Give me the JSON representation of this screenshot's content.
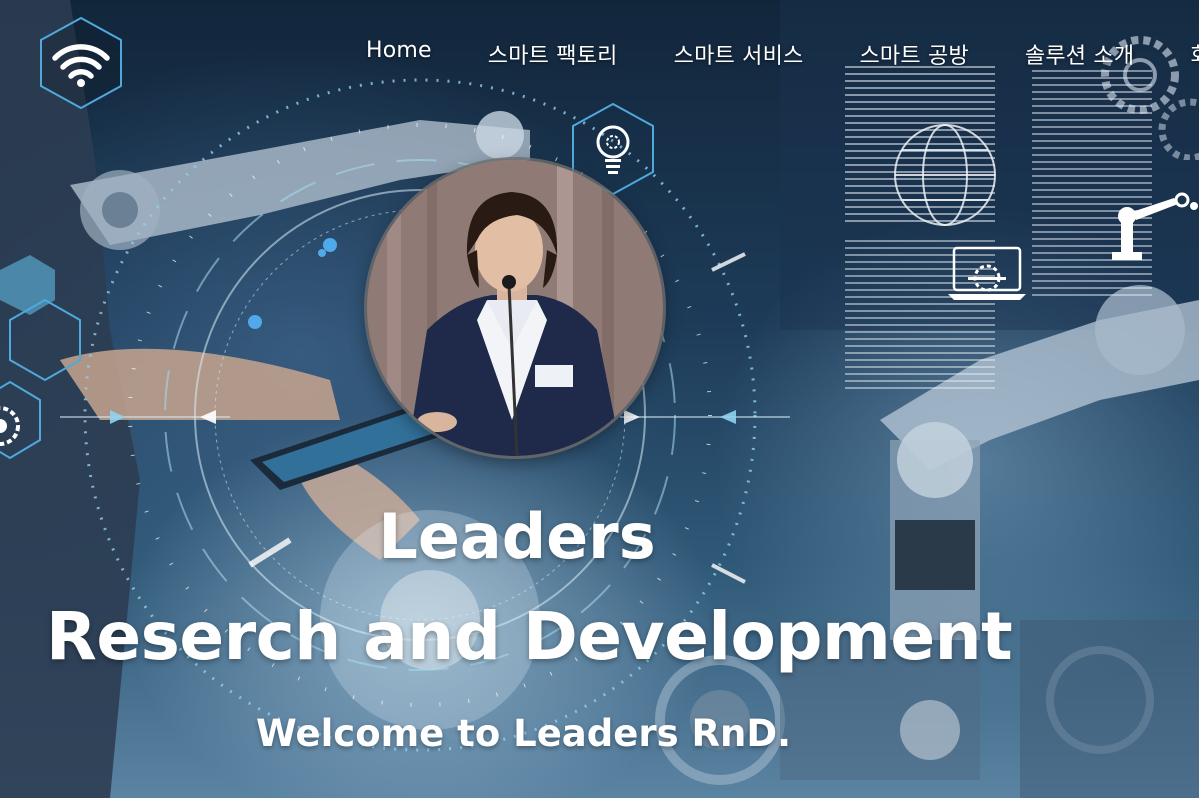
{
  "nav": {
    "items": [
      {
        "label": "Home"
      },
      {
        "label": "스마트 팩토리"
      },
      {
        "label": "스마트 서비스"
      },
      {
        "label": "스마트 공방"
      },
      {
        "label": "솔루션 소개"
      },
      {
        "label": "회"
      }
    ]
  },
  "hero": {
    "line1": "Leaders",
    "line2": "Reserch and Development",
    "subtitle": "Welcome to Leaders RnD."
  },
  "icons": {
    "logo": "wifi-icon",
    "idea": "lightbulb-gear-icon",
    "globe": "globe-icon",
    "laptop": "laptop-gear-icon",
    "robot": "robot-arm-icon",
    "portrait": "speaker-portrait"
  },
  "colors": {
    "hud_cyan": "#8fd3f0",
    "hex_outline": "#4fa9dd",
    "text": "#ffffff"
  }
}
